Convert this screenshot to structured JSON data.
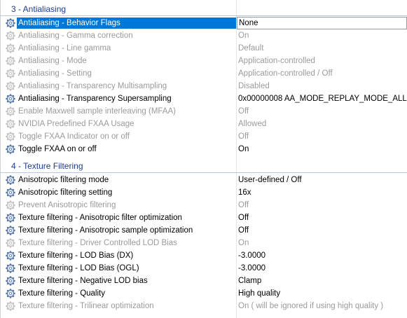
{
  "colors": {
    "accent": "#0078d7",
    "section_text": "#1f3c8f",
    "disabled_text": "#9b9b9b"
  },
  "sections": [
    {
      "title": "3 - Antialiasing",
      "rows": [
        {
          "name": "Antialiasing - Behavior Flags",
          "value": "None",
          "enabled": true,
          "selected": true
        },
        {
          "name": "Antialiasing - Gamma correction",
          "value": "On",
          "enabled": false
        },
        {
          "name": "Antialiasing - Line gamma",
          "value": "Default",
          "enabled": false
        },
        {
          "name": "Antialiasing - Mode",
          "value": "Application-controlled",
          "enabled": false
        },
        {
          "name": "Antialiasing - Setting",
          "value": "Application-controlled / Off",
          "enabled": false
        },
        {
          "name": "Antialiasing - Transparency Multisampling",
          "value": "Disabled",
          "enabled": false
        },
        {
          "name": "Antialiasing - Transparency Supersampling",
          "value": "0x00000008 AA_MODE_REPLAY_MODE_ALL",
          "enabled": true
        },
        {
          "name": "Enable Maxwell sample interleaving (MFAA)",
          "value": "Off",
          "enabled": false
        },
        {
          "name": "NVIDIA Predefined FXAA Usage",
          "value": "Allowed",
          "enabled": false
        },
        {
          "name": "Toggle FXAA Indicator on or off",
          "value": "Off",
          "enabled": false
        },
        {
          "name": "Toggle FXAA on or off",
          "value": "On",
          "enabled": true
        }
      ]
    },
    {
      "title": "4 - Texture Filtering",
      "rows": [
        {
          "name": "Anisotropic filtering mode",
          "value": "User-defined / Off",
          "enabled": true
        },
        {
          "name": "Anisotropic filtering setting",
          "value": "16x",
          "enabled": true
        },
        {
          "name": "Prevent Anisotropic filtering",
          "value": "Off",
          "enabled": false
        },
        {
          "name": "Texture filtering - Anisotropic filter optimization",
          "value": "Off",
          "enabled": true
        },
        {
          "name": "Texture filtering - Anisotropic sample optimization",
          "value": "Off",
          "enabled": true
        },
        {
          "name": "Texture filtering - Driver Controlled LOD Bias",
          "value": "On",
          "enabled": false
        },
        {
          "name": "Texture filtering - LOD Bias (DX)",
          "value": "-3.0000",
          "enabled": true
        },
        {
          "name": "Texture filtering - LOD Bias (OGL)",
          "value": "-3.0000",
          "enabled": true
        },
        {
          "name": "Texture filtering - Negative LOD bias",
          "value": "Clamp",
          "enabled": true
        },
        {
          "name": "Texture filtering - Quality",
          "value": "High quality",
          "enabled": true
        },
        {
          "name": "Texture filtering - Trilinear optimization",
          "value": "On ( will be ignored if using high quality )",
          "enabled": false
        }
      ]
    }
  ]
}
